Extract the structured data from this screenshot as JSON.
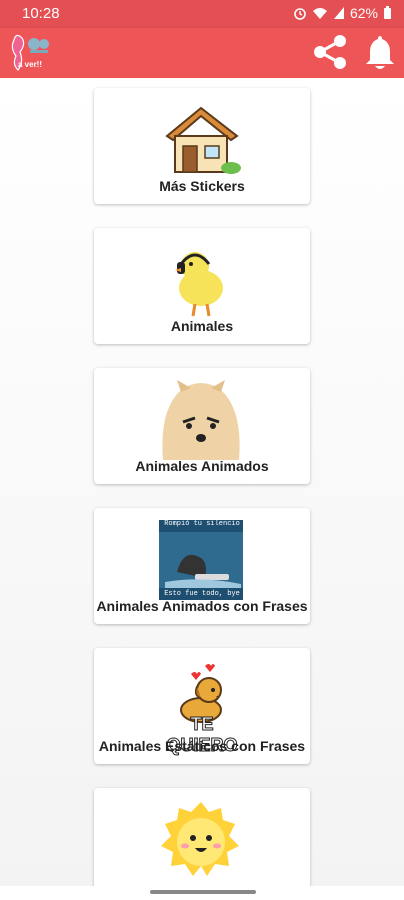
{
  "status_bar": {
    "time": "10:28",
    "battery": "62%",
    "icons": [
      "alarm-icon",
      "wifi-icon",
      "signal-icon",
      "battery-icon"
    ]
  },
  "app_bar": {
    "logo_text": "a ver!!",
    "background": "#ee5557",
    "actions": [
      "share-icon",
      "bell-icon"
    ]
  },
  "categories": [
    {
      "label": "Más Stickers",
      "thumbnail": "house"
    },
    {
      "label": "Animales",
      "thumbnail": "chick-with-headphones"
    },
    {
      "label": "Animales Animados",
      "thumbnail": "pomeranian-dog"
    },
    {
      "label": "Animales Animados con Frases",
      "thumbnail": "cat-sticker-meme",
      "meme_top": "Rompió tu silencio",
      "meme_bottom": "Esto fue todo, bye"
    },
    {
      "label": "Animales Estáticos con Frases",
      "thumbnail": "dog-with-hearts",
      "caption": "TE QUIERO"
    },
    {
      "label": "",
      "thumbnail": "smiling-sun"
    }
  ]
}
